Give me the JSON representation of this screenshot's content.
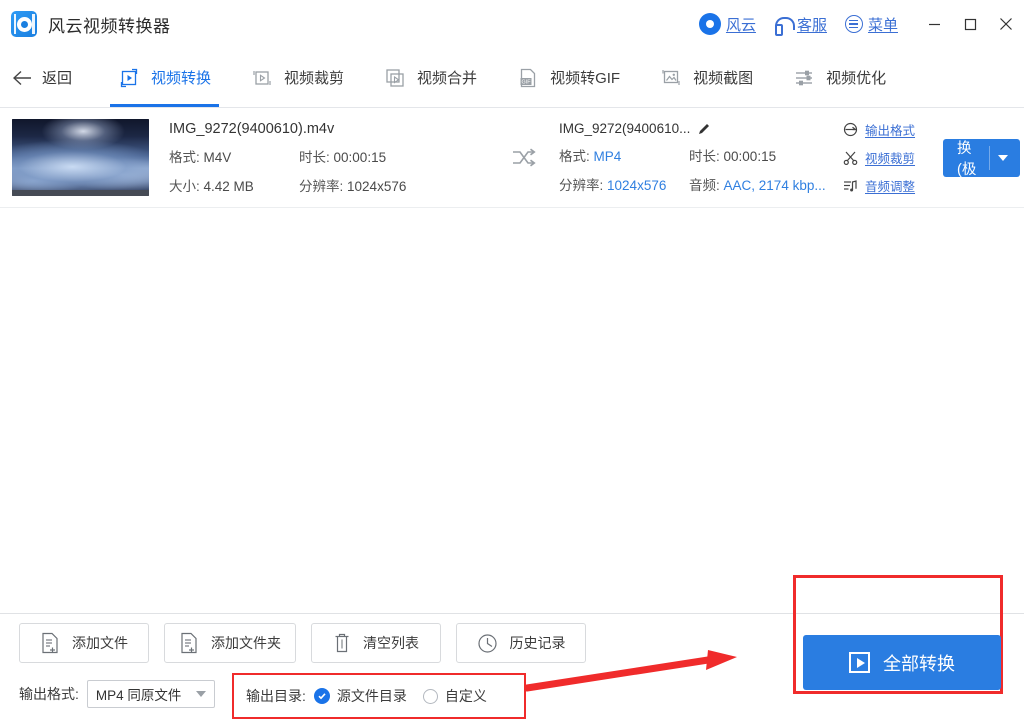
{
  "titlebar": {
    "app_name": "风云视频转换器",
    "logo_icon": "video-converter-logo",
    "items": [
      {
        "icon": "fengyun-circle-icon",
        "label": "风云"
      },
      {
        "icon": "headset-icon",
        "label": "客服"
      },
      {
        "icon": "menu-list-icon",
        "label": "菜单"
      }
    ],
    "window_controls": {
      "minimize": "minimize-icon",
      "maximize": "maximize-icon",
      "close": "close-icon"
    }
  },
  "nav": {
    "back_label": "返回",
    "back_icon": "arrow-left-icon",
    "tabs": [
      {
        "label": "视频转换",
        "icon": "video-convert-icon",
        "active": true
      },
      {
        "label": "视频裁剪",
        "icon": "video-crop-icon",
        "active": false
      },
      {
        "label": "视频合并",
        "icon": "video-merge-icon",
        "active": false
      },
      {
        "label": "视频转GIF",
        "icon": "gif-icon",
        "active": false
      },
      {
        "label": "视频截图",
        "icon": "screenshot-icon",
        "active": false
      },
      {
        "label": "视频优化",
        "icon": "sliders-icon",
        "active": false
      }
    ]
  },
  "file_row": {
    "thumbnail_alt": "night-clouds-thumbnail",
    "source": {
      "filename": "IMG_9272(9400610).m4v",
      "format_label": "格式:",
      "format_value": "M4V",
      "duration_label": "时长:",
      "duration_value": "00:00:15",
      "size_label": "大小:",
      "size_value": "4.42 MB",
      "resolution_label": "分辨率:",
      "resolution_value": "1024x576"
    },
    "swap_icon": "shuffle-arrows-icon",
    "output": {
      "filename": "IMG_9272(9400610...",
      "edit_icon": "pencil-edit-icon",
      "format_label": "格式:",
      "format_value": "MP4",
      "duration_label": "时长:",
      "duration_value": "00:00:15",
      "resolution_label": "分辨率:",
      "resolution_value": "1024x576",
      "audio_label": "音频:",
      "audio_value": "AAC, 2174 kbp..."
    },
    "side_actions": [
      {
        "icon": "output-format-icon",
        "label": "输出格式"
      },
      {
        "icon": "scissors-icon",
        "label": "视频裁剪"
      },
      {
        "icon": "audio-adjust-icon",
        "label": "音频调整"
      }
    ],
    "convert_button": {
      "label": "转换(极速)",
      "caret_icon": "chevron-down-icon"
    }
  },
  "bottom": {
    "buttons": [
      {
        "icon": "add-file-icon",
        "label": "添加文件"
      },
      {
        "icon": "add-folder-icon",
        "label": "添加文件夹"
      },
      {
        "icon": "trash-icon",
        "label": "清空列表"
      },
      {
        "icon": "clock-history-icon",
        "label": "历史记录"
      }
    ],
    "output_format": {
      "label": "输出格式:",
      "value": "MP4 同原文件",
      "caret_icon": "chevron-down-icon"
    },
    "output_dir": {
      "label": "输出目录:",
      "options": [
        {
          "label": "源文件目录",
          "selected": true
        },
        {
          "label": "自定义",
          "selected": false
        }
      ]
    },
    "convert_all": {
      "label": "全部转换",
      "icon": "play-button-icon"
    }
  },
  "annotations": {
    "highlight_color": "#f02b2b",
    "arrow_icon": "red-arrow-annotation"
  },
  "colors": {
    "accent_blue": "#2a7de1",
    "link_blue": "#3b6fd4",
    "value_blue": "#2f7fe0",
    "highlight_red": "#f02b2b"
  }
}
